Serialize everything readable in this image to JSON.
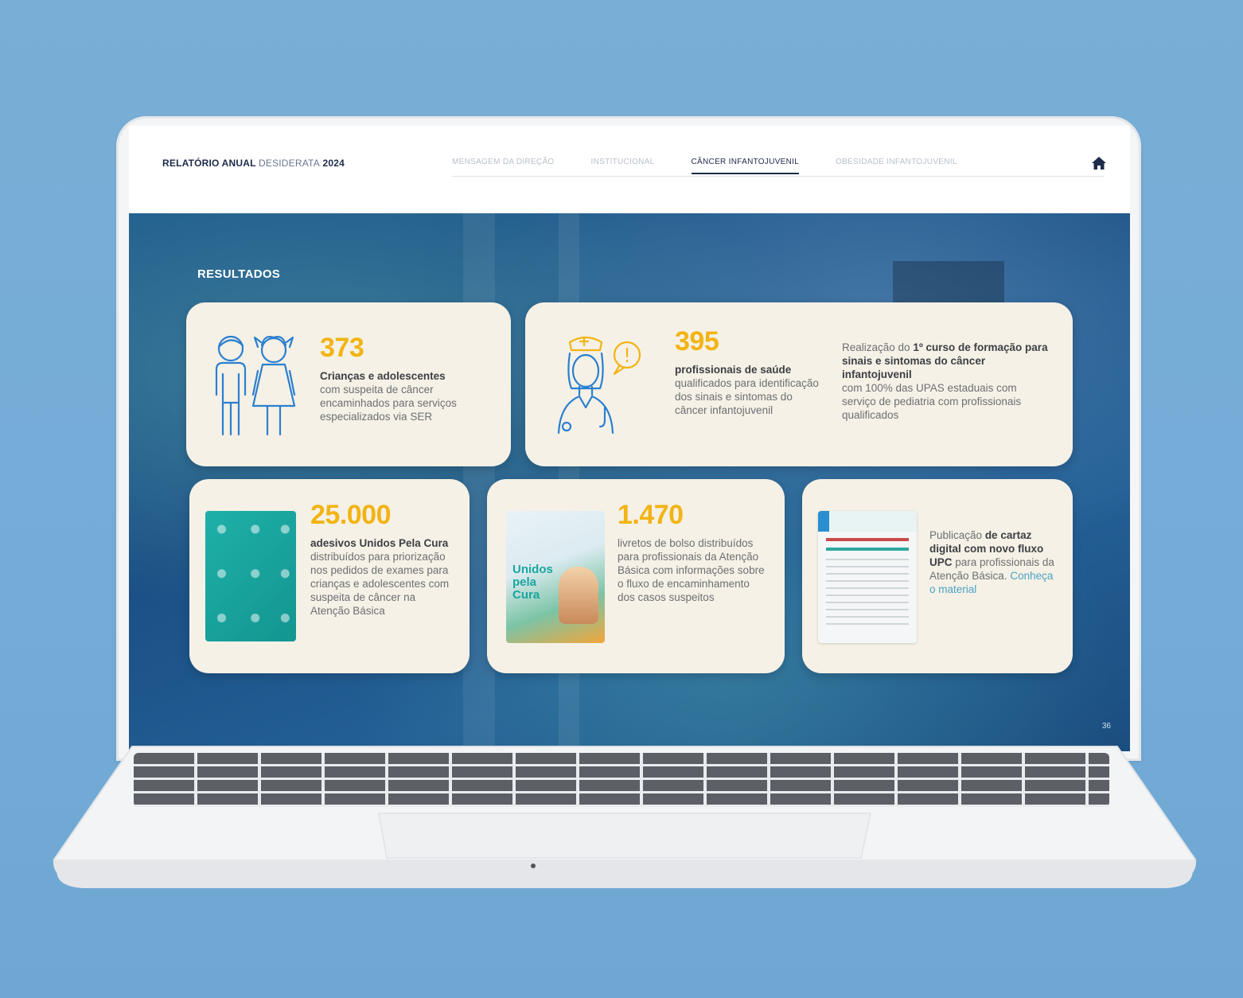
{
  "header": {
    "title_bold": "RELATÓRIO ANUAL",
    "title_light": "DESIDERATA",
    "title_year": "2024",
    "nav": [
      {
        "label": "MENSAGEM DA DIREÇÃO",
        "active": false
      },
      {
        "label": "INSTITUCIONAL",
        "active": false
      },
      {
        "label": "CÂNCER INFANTOJUVENIL",
        "active": true
      },
      {
        "label": "OBESIDADE INFANTOJUVENIL",
        "active": false
      }
    ]
  },
  "section": {
    "title": "RESULTADOS"
  },
  "cards": {
    "c1": {
      "number": "373",
      "bold": "Crianças e adolescentes",
      "text": "com suspeita de câncer encaminhados para serviços especializados via SER"
    },
    "c2": {
      "number": "395",
      "bold": "profissionais de saúde",
      "text": "qualificados para identificação dos sinais e sintomas do câncer infantojuvenil",
      "side_prefix": "Realização do",
      "side_bold": "1º curso de formação para sinais e sintomas do câncer infantojuvenil",
      "side_text": "com 100% das UPAS estaduais com serviço de pediatria com profissionais qualificados"
    },
    "c3": {
      "number": "25.000",
      "bold": "adesivos Unidos Pela Cura",
      "text": "distribuídos para priorização nos pedidos de exames para crianças e adolescentes com suspeita de câncer na Atenção Básica"
    },
    "c4": {
      "number": "1.470",
      "text": "livretos de bolso distribuídos para profissionais da Atenção Básica com informações sobre o fluxo de encaminhamento dos casos suspeitos",
      "thumb_text": "Unidos pela Cura"
    },
    "c5": {
      "prefix": "Publicação",
      "bold1": "de",
      "bold2": "cartaz digital com novo fluxo UPC",
      "text": "para profissionais da Atenção Básica.",
      "link": "Conheça o material"
    }
  },
  "page_number": "36",
  "colors": {
    "accent": "#f2b414",
    "icon_blue": "#2b7fd0",
    "card_bg": "#f5f1e6",
    "teal": "#17a2a0"
  }
}
